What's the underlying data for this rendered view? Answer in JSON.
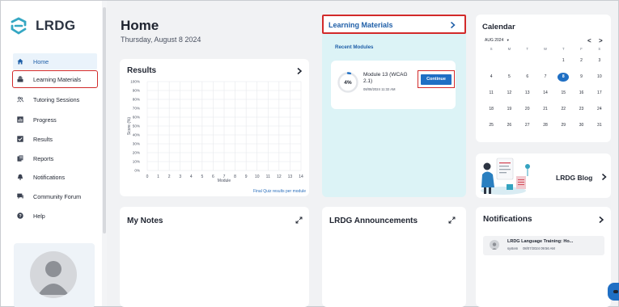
{
  "app": {
    "logo_text": "LRDG"
  },
  "sidebar": {
    "items": [
      {
        "label": "Home",
        "icon": "home-icon",
        "active": true
      },
      {
        "label": "Learning Materials",
        "icon": "book-stack-icon",
        "highlighted": true
      },
      {
        "label": "Tutoring Sessions",
        "icon": "users-icon"
      },
      {
        "label": "Progress",
        "icon": "bar-chart-icon"
      },
      {
        "label": "Results",
        "icon": "checkbox-icon"
      },
      {
        "label": "Reports",
        "icon": "document-icon"
      },
      {
        "label": "Notifications",
        "icon": "bell-icon"
      },
      {
        "label": "Community Forum",
        "icon": "forum-icon"
      },
      {
        "label": "Help",
        "icon": "help-icon"
      }
    ]
  },
  "header": {
    "title": "Home",
    "date": "Thursday, August 8 2024"
  },
  "results": {
    "title": "Results",
    "caption": "Final Quiz results per module"
  },
  "chart_data": {
    "type": "bar",
    "title": "Results",
    "xlabel": "Module",
    "ylabel": "Score (%)",
    "categories": [
      "0",
      "1",
      "2",
      "3",
      "4",
      "5",
      "6",
      "7",
      "8",
      "9",
      "10",
      "11",
      "12",
      "13",
      "14"
    ],
    "values": [],
    "ylim": [
      0,
      100
    ],
    "y_ticks": [
      "100%",
      "90%",
      "80%",
      "70%",
      "60%",
      "50%",
      "40%",
      "30%",
      "20%",
      "10%",
      "0%"
    ],
    "grid": true,
    "caption": "Final Quiz results per module"
  },
  "learning": {
    "title": "Learning Materials",
    "subtitle": "Recent Modules",
    "module": {
      "title": "Module 13 (WCAG 2.1)",
      "time": "08/08/2024 11:32 AM",
      "progress_label": "4%",
      "progress_fraction": 0.04,
      "button_label": "Continue"
    }
  },
  "calendar": {
    "title": "Calendar",
    "month_label": "AUG 2024",
    "prev_label": "<",
    "next_label": ">",
    "weekdays": [
      "S",
      "M",
      "T",
      "W",
      "T",
      "F",
      "S"
    ],
    "weeks": [
      [
        "",
        "",
        "",
        "",
        "1",
        "2",
        "3"
      ],
      [
        "4",
        "5",
        "6",
        "7",
        "8",
        "9",
        "10"
      ],
      [
        "11",
        "12",
        "13",
        "14",
        "15",
        "16",
        "17"
      ],
      [
        "18",
        "19",
        "20",
        "21",
        "22",
        "23",
        "24"
      ],
      [
        "25",
        "26",
        "27",
        "28",
        "29",
        "30",
        "31"
      ]
    ],
    "selected_day": "8"
  },
  "blog": {
    "title": "LRDG Blog"
  },
  "notes": {
    "title": "My Notes"
  },
  "announcements": {
    "title": "LRDG Announcements"
  },
  "notifications": {
    "title": "Notifications",
    "items": [
      {
        "title": "LRDG Language Training: Ho...",
        "sender": "system",
        "time": "08/07/2024  09:56 AM"
      }
    ]
  },
  "colors": {
    "accent": "#1f6fc4",
    "highlight_border": "#d22a2a",
    "learning_bg": "#dcf3f6",
    "page_bg": "#f1f2f4"
  }
}
